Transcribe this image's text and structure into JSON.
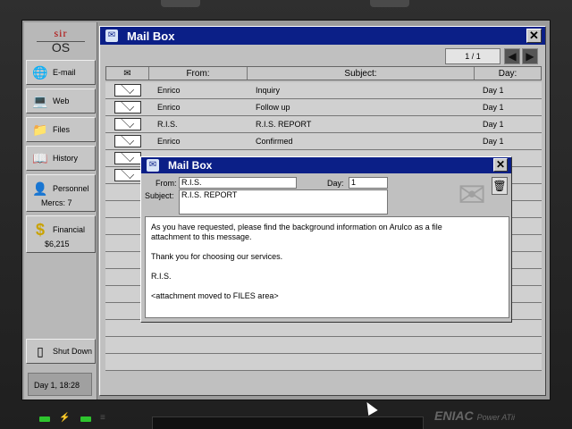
{
  "sidebar": {
    "logo_top": "sir",
    "logo_bottom": "OS",
    "items": [
      {
        "label": "E-mail",
        "icon": "email-icon"
      },
      {
        "label": "Web",
        "icon": "web-icon"
      },
      {
        "label": "Files",
        "icon": "files-icon"
      },
      {
        "label": "History",
        "icon": "history-icon"
      },
      {
        "label": "Personnel",
        "sub": "Mercs: 7",
        "icon": "personnel-icon"
      },
      {
        "label": "Financial",
        "sub": "$6,215",
        "icon": "financial-icon"
      }
    ],
    "shutdown_label": "Shut Down",
    "datetime": "Day 1, 18:28"
  },
  "mailbox": {
    "title": "Mail Box",
    "page": "1 / 1",
    "columns": {
      "from": "From:",
      "subject": "Subject:",
      "day": "Day:"
    },
    "rows": [
      {
        "from": "Enrico",
        "subject": "Inquiry",
        "day": "Day 1"
      },
      {
        "from": "Enrico",
        "subject": "Follow up",
        "day": "Day 1"
      },
      {
        "from": "R.I.S.",
        "subject": "R.I.S. REPORT",
        "day": "Day 1"
      },
      {
        "from": "Enrico",
        "subject": "Confirmed",
        "day": "Day 1"
      }
    ]
  },
  "message": {
    "title": "Mail Box",
    "from_label": "From:",
    "from_value": "R.I.S.",
    "day_label": "Day:",
    "day_value": "1",
    "subject_label": "Subject:",
    "subject_value": "R.I.S. REPORT",
    "body": "As you have requested, please find the background information on Arulco as a file\nattachment to this message.\n\nThank you for choosing our services.\n\nR.I.S.\n\n<attachment moved to FILES area>"
  },
  "brand": {
    "name": "ENIAC",
    "model": "Power ATii"
  },
  "colors": {
    "titlebar": "#0b1f87",
    "led": "#2ec42e",
    "logo_red": "#b00000"
  }
}
